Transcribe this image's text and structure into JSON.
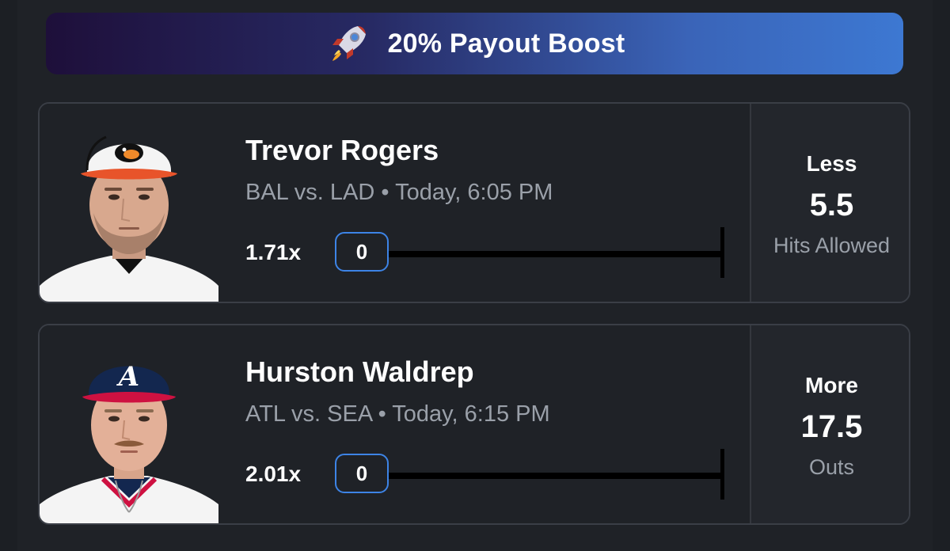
{
  "banner": {
    "icon": "rocket-icon",
    "label": "20% Payout Boost"
  },
  "picks": [
    {
      "player_name": "Trevor Rogers",
      "matchup": "BAL vs. LAD • Today, 6:05 PM",
      "multiplier": "1.71x",
      "progress_value": "0",
      "direction": "Less",
      "line": "5.5",
      "stat": "Hits Allowed",
      "team_colors": {
        "cap": "#ffffff",
        "brim": "#e8542a",
        "jersey": "#ffffff",
        "collar": "#111111"
      }
    },
    {
      "player_name": "Hurston Waldrep",
      "matchup": "ATL vs. SEA • Today, 6:15 PM",
      "multiplier": "2.01x",
      "progress_value": "0",
      "direction": "More",
      "line": "17.5",
      "stat": "Outs",
      "team_colors": {
        "cap": "#13274f",
        "brim": "#ce1141",
        "jersey": "#ffffff",
        "collar": "#13274f"
      }
    }
  ],
  "colors": {
    "accent": "#3d84e6",
    "background": "#1f2227",
    "muted_text": "#9aa0a9"
  }
}
